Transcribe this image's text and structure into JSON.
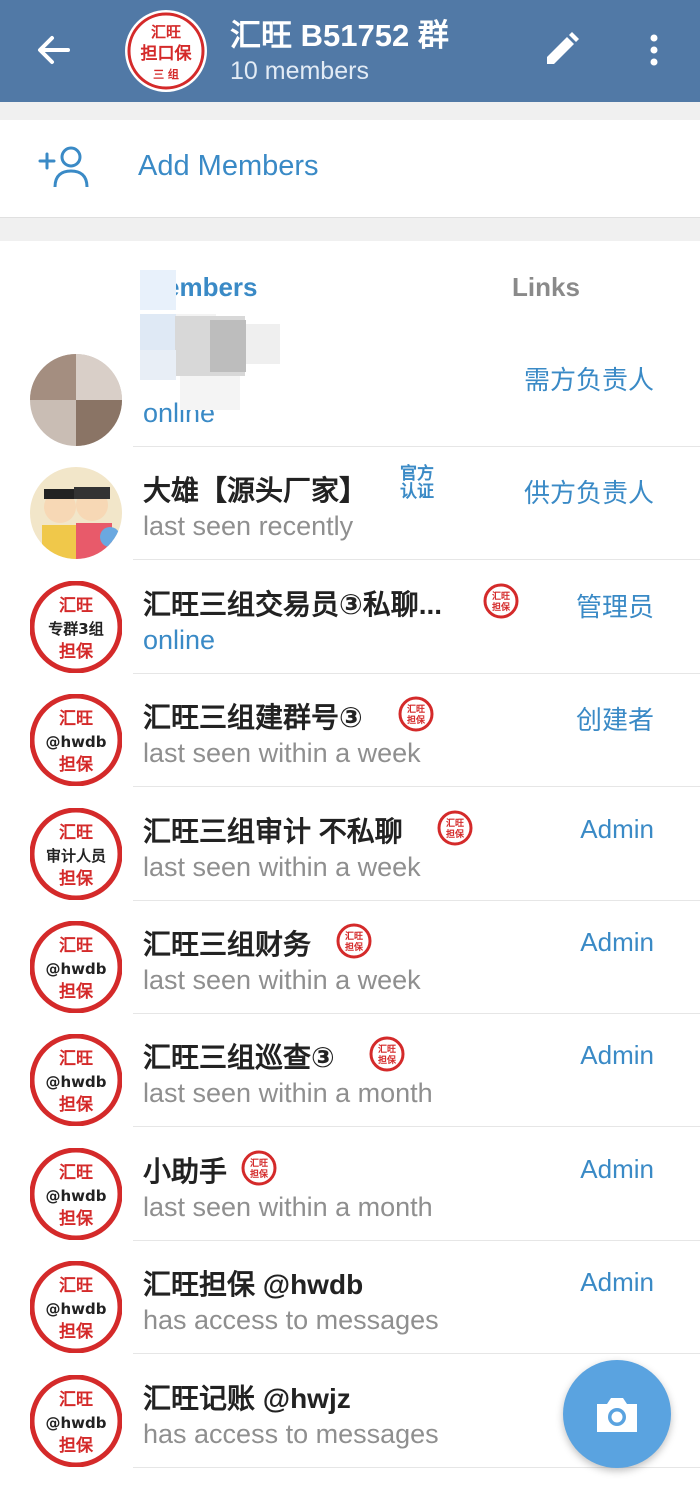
{
  "header": {
    "title": "汇旺 B51752 群",
    "subtitle": "10 members",
    "avatar_lines": [
      "汇旺",
      "担口保",
      "三 组"
    ]
  },
  "add_members": {
    "label": "Add Members"
  },
  "tabs": {
    "members": "embers",
    "links": "Links"
  },
  "badge_text": [
    "汇旺",
    "担保"
  ],
  "verified_text": [
    "官方",
    "认证"
  ],
  "members": [
    {
      "name": "",
      "status": "online",
      "role": "需方负责人"
    },
    {
      "name": "大雄【源头厂家】",
      "status": "last seen recently",
      "role": "供方负责人"
    },
    {
      "name": "汇旺三组交易员③私聊...",
      "status": "online",
      "role": "管理员",
      "avatar_mid": "专群3组"
    },
    {
      "name": "汇旺三组建群号③",
      "status": "last seen within a week",
      "role": "创建者",
      "avatar_mid": "@hwdb"
    },
    {
      "name": "汇旺三组审计 不私聊",
      "status": "last seen within a week",
      "role": "Admin",
      "avatar_mid": "审计人员"
    },
    {
      "name": "汇旺三组财务",
      "status": "last seen within a week",
      "role": "Admin",
      "avatar_mid": "@hwdb"
    },
    {
      "name": "汇旺三组巡查③",
      "status": "last seen within a month",
      "role": "Admin",
      "avatar_mid": "@hwdb"
    },
    {
      "name": "小助手",
      "status": "last seen within a month",
      "role": "Admin",
      "avatar_mid": "@hwdb"
    },
    {
      "name": "汇旺担保 @hwdb",
      "status": "has access to messages",
      "role": "Admin",
      "avatar_mid": "@hwdb"
    },
    {
      "name": "汇旺记账 @hwjz",
      "status": "has access to messages",
      "role": "",
      "avatar_mid": "@hwdb"
    }
  ],
  "avatar_top": "汇旺",
  "avatar_bottom": "担保",
  "colors": {
    "header": "#5179a6",
    "accent": "#3a8ac6",
    "badge_red": "#d42a2a",
    "fab": "#5aa3e0"
  }
}
